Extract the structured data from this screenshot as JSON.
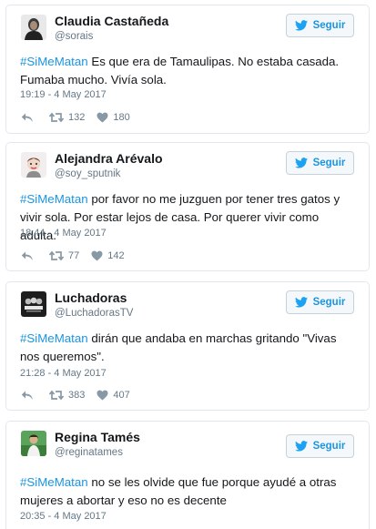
{
  "follow_label": "Seguir",
  "colors": {
    "link": "#1b95e0",
    "border": "#e1e8ed",
    "muted": "#657786",
    "icon": "#8899a6"
  },
  "tweets": [
    {
      "name": "Claudia Castañeda",
      "handle": "@sorais",
      "hashtag": "#SiMeMatan",
      "text": " Es que era de Tamaulipas. No estaba casada. Fumaba mucho. Vivía sola.",
      "timestamp": "19:19 - 4 May 2017",
      "retweets": "132",
      "likes": "180"
    },
    {
      "name": "Alejandra Arévalo",
      "handle": "@soy_sputnik",
      "hashtag": "#SiMeMatan",
      "text": " por favor no me juzguen por tener tres gatos y vivir sola. Por estar lejos de casa. Por querer vivir como adulta.",
      "timestamp": "18:44 - 4 May 2017",
      "retweets": "77",
      "likes": "142"
    },
    {
      "name": "Luchadoras",
      "handle": "@LuchadorasTV",
      "hashtag": "#SiMeMatan",
      "text": " dirán que andaba en marchas gritando \"Vivas nos queremos\".",
      "timestamp": "21:28 - 4 May 2017",
      "retweets": "383",
      "likes": "407"
    },
    {
      "name": "Regina Tamés",
      "handle": "@reginatames",
      "hashtag": "#SiMeMatan",
      "text": " no se les olvide que fue porque ayudé a otras mujeres a abortar y eso no es decente",
      "timestamp": "20:35 - 4 May 2017"
    }
  ]
}
